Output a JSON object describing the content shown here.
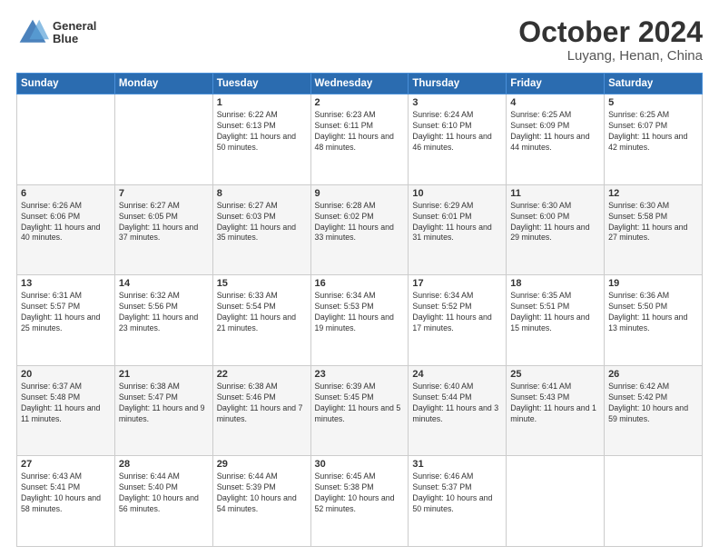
{
  "header": {
    "logo_line1": "General",
    "logo_line2": "Blue",
    "month": "October 2024",
    "location": "Luyang, Henan, China"
  },
  "weekdays": [
    "Sunday",
    "Monday",
    "Tuesday",
    "Wednesday",
    "Thursday",
    "Friday",
    "Saturday"
  ],
  "weeks": [
    [
      {
        "day": "",
        "sunrise": "",
        "sunset": "",
        "daylight": ""
      },
      {
        "day": "",
        "sunrise": "",
        "sunset": "",
        "daylight": ""
      },
      {
        "day": "1",
        "sunrise": "Sunrise: 6:22 AM",
        "sunset": "Sunset: 6:13 PM",
        "daylight": "Daylight: 11 hours and 50 minutes."
      },
      {
        "day": "2",
        "sunrise": "Sunrise: 6:23 AM",
        "sunset": "Sunset: 6:11 PM",
        "daylight": "Daylight: 11 hours and 48 minutes."
      },
      {
        "day": "3",
        "sunrise": "Sunrise: 6:24 AM",
        "sunset": "Sunset: 6:10 PM",
        "daylight": "Daylight: 11 hours and 46 minutes."
      },
      {
        "day": "4",
        "sunrise": "Sunrise: 6:25 AM",
        "sunset": "Sunset: 6:09 PM",
        "daylight": "Daylight: 11 hours and 44 minutes."
      },
      {
        "day": "5",
        "sunrise": "Sunrise: 6:25 AM",
        "sunset": "Sunset: 6:07 PM",
        "daylight": "Daylight: 11 hours and 42 minutes."
      }
    ],
    [
      {
        "day": "6",
        "sunrise": "Sunrise: 6:26 AM",
        "sunset": "Sunset: 6:06 PM",
        "daylight": "Daylight: 11 hours and 40 minutes."
      },
      {
        "day": "7",
        "sunrise": "Sunrise: 6:27 AM",
        "sunset": "Sunset: 6:05 PM",
        "daylight": "Daylight: 11 hours and 37 minutes."
      },
      {
        "day": "8",
        "sunrise": "Sunrise: 6:27 AM",
        "sunset": "Sunset: 6:03 PM",
        "daylight": "Daylight: 11 hours and 35 minutes."
      },
      {
        "day": "9",
        "sunrise": "Sunrise: 6:28 AM",
        "sunset": "Sunset: 6:02 PM",
        "daylight": "Daylight: 11 hours and 33 minutes."
      },
      {
        "day": "10",
        "sunrise": "Sunrise: 6:29 AM",
        "sunset": "Sunset: 6:01 PM",
        "daylight": "Daylight: 11 hours and 31 minutes."
      },
      {
        "day": "11",
        "sunrise": "Sunrise: 6:30 AM",
        "sunset": "Sunset: 6:00 PM",
        "daylight": "Daylight: 11 hours and 29 minutes."
      },
      {
        "day": "12",
        "sunrise": "Sunrise: 6:30 AM",
        "sunset": "Sunset: 5:58 PM",
        "daylight": "Daylight: 11 hours and 27 minutes."
      }
    ],
    [
      {
        "day": "13",
        "sunrise": "Sunrise: 6:31 AM",
        "sunset": "Sunset: 5:57 PM",
        "daylight": "Daylight: 11 hours and 25 minutes."
      },
      {
        "day": "14",
        "sunrise": "Sunrise: 6:32 AM",
        "sunset": "Sunset: 5:56 PM",
        "daylight": "Daylight: 11 hours and 23 minutes."
      },
      {
        "day": "15",
        "sunrise": "Sunrise: 6:33 AM",
        "sunset": "Sunset: 5:54 PM",
        "daylight": "Daylight: 11 hours and 21 minutes."
      },
      {
        "day": "16",
        "sunrise": "Sunrise: 6:34 AM",
        "sunset": "Sunset: 5:53 PM",
        "daylight": "Daylight: 11 hours and 19 minutes."
      },
      {
        "day": "17",
        "sunrise": "Sunrise: 6:34 AM",
        "sunset": "Sunset: 5:52 PM",
        "daylight": "Daylight: 11 hours and 17 minutes."
      },
      {
        "day": "18",
        "sunrise": "Sunrise: 6:35 AM",
        "sunset": "Sunset: 5:51 PM",
        "daylight": "Daylight: 11 hours and 15 minutes."
      },
      {
        "day": "19",
        "sunrise": "Sunrise: 6:36 AM",
        "sunset": "Sunset: 5:50 PM",
        "daylight": "Daylight: 11 hours and 13 minutes."
      }
    ],
    [
      {
        "day": "20",
        "sunrise": "Sunrise: 6:37 AM",
        "sunset": "Sunset: 5:48 PM",
        "daylight": "Daylight: 11 hours and 11 minutes."
      },
      {
        "day": "21",
        "sunrise": "Sunrise: 6:38 AM",
        "sunset": "Sunset: 5:47 PM",
        "daylight": "Daylight: 11 hours and 9 minutes."
      },
      {
        "day": "22",
        "sunrise": "Sunrise: 6:38 AM",
        "sunset": "Sunset: 5:46 PM",
        "daylight": "Daylight: 11 hours and 7 minutes."
      },
      {
        "day": "23",
        "sunrise": "Sunrise: 6:39 AM",
        "sunset": "Sunset: 5:45 PM",
        "daylight": "Daylight: 11 hours and 5 minutes."
      },
      {
        "day": "24",
        "sunrise": "Sunrise: 6:40 AM",
        "sunset": "Sunset: 5:44 PM",
        "daylight": "Daylight: 11 hours and 3 minutes."
      },
      {
        "day": "25",
        "sunrise": "Sunrise: 6:41 AM",
        "sunset": "Sunset: 5:43 PM",
        "daylight": "Daylight: 11 hours and 1 minute."
      },
      {
        "day": "26",
        "sunrise": "Sunrise: 6:42 AM",
        "sunset": "Sunset: 5:42 PM",
        "daylight": "Daylight: 10 hours and 59 minutes."
      }
    ],
    [
      {
        "day": "27",
        "sunrise": "Sunrise: 6:43 AM",
        "sunset": "Sunset: 5:41 PM",
        "daylight": "Daylight: 10 hours and 58 minutes."
      },
      {
        "day": "28",
        "sunrise": "Sunrise: 6:44 AM",
        "sunset": "Sunset: 5:40 PM",
        "daylight": "Daylight: 10 hours and 56 minutes."
      },
      {
        "day": "29",
        "sunrise": "Sunrise: 6:44 AM",
        "sunset": "Sunset: 5:39 PM",
        "daylight": "Daylight: 10 hours and 54 minutes."
      },
      {
        "day": "30",
        "sunrise": "Sunrise: 6:45 AM",
        "sunset": "Sunset: 5:38 PM",
        "daylight": "Daylight: 10 hours and 52 minutes."
      },
      {
        "day": "31",
        "sunrise": "Sunrise: 6:46 AM",
        "sunset": "Sunset: 5:37 PM",
        "daylight": "Daylight: 10 hours and 50 minutes."
      },
      {
        "day": "",
        "sunrise": "",
        "sunset": "",
        "daylight": ""
      },
      {
        "day": "",
        "sunrise": "",
        "sunset": "",
        "daylight": ""
      }
    ]
  ]
}
